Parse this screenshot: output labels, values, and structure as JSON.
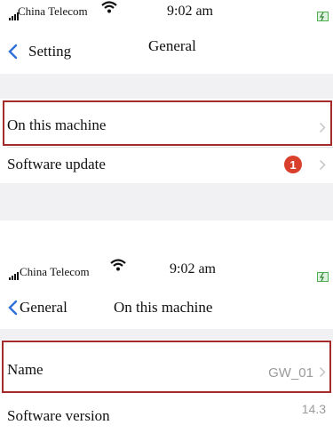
{
  "screen_general": {
    "status": {
      "carrier": "China Telecom",
      "time": "9:02 am"
    },
    "nav": {
      "back_label": "Setting",
      "title": "General"
    },
    "rows": [
      {
        "label": "On this machine"
      },
      {
        "label": "Software update",
        "badge": "1"
      }
    ]
  },
  "screen_machine": {
    "status": {
      "carrier": "China Telecom",
      "time": "9:02 am"
    },
    "nav": {
      "back_label": "General",
      "title": "On this machine"
    },
    "rows": [
      {
        "label": "Name",
        "value": "GW_01"
      },
      {
        "label": "Software version",
        "value": "14.3"
      }
    ]
  },
  "colors": {
    "accent": "#2f6fd8",
    "highlight": "#a52b2b",
    "badge": "#d9402b",
    "battery": "#4caf50"
  }
}
